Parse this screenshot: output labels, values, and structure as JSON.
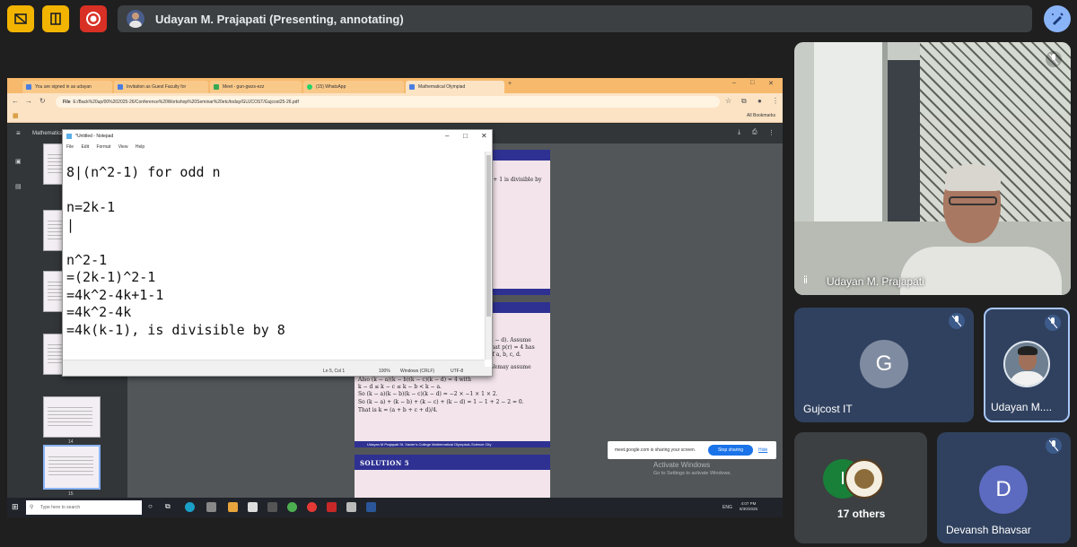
{
  "meet": {
    "presenter_label": "Udayan M. Prajapati (Presenting, annotating)",
    "participants": [
      {
        "name": "Udayan M. Prajapati"
      },
      {
        "name": "Gujcost IT",
        "initial": "G",
        "color": "#7f8ba0"
      },
      {
        "name": "Udayan M...."
      },
      {
        "summary": "17 others",
        "initial": "I",
        "initial_color": "#188038"
      },
      {
        "name": "Devansh Bhavsar",
        "initial": "D",
        "color": "#5c6bc0"
      }
    ]
  },
  "browser": {
    "tabs": [
      {
        "label": "You are signed in as udayan"
      },
      {
        "label": "Invitation as Guest Faculty for"
      },
      {
        "label": "Meet - gun-gwzs-ezz"
      },
      {
        "label": "(15) WhatsApp"
      },
      {
        "label": "Mathematical Olympiad"
      }
    ],
    "new_tab": "+",
    "file_label": "File",
    "url": "E:/Back%20up/00%202025-26/Conference%20Workshop%20Seminar%20etc/today/GUJCOST/Gujcost25-26.pdf",
    "all_bookmarks": "All Bookmarks",
    "pdf_title": "Mathematica",
    "thumb_numbers": [
      "14",
      "15"
    ]
  },
  "notepad": {
    "title": "*Untitled - Notepad",
    "menu": [
      "File",
      "Edit",
      "Format",
      "View",
      "Help"
    ],
    "content": "8|(n^2-1) for odd n\n\nn=2k-1\n|\n\nn^2-1\n=(2k-1)^2-1\n=4k^2-4k+1-1\n=4k^2-4k\n=4k(k-1), is divisible by 8",
    "status": {
      "pos": "Ln 5, Col 1",
      "zoom": "100%",
      "eol": "Windows (CRLF)",
      "encoding": "UTF-8"
    }
  },
  "pdf_pages": {
    "page1_snippet": "² + 1 is divisible by",
    "page2_lines": [
      "c)(x − d). Assume",
      "that p(r) = 4 has",
      "of a, b, c, d.",
      "Wemay assume",
      "Also (k − a)(k − b)(k − c)(k − d) = 4 with",
      "k − d ≤ k − c ≤ k − b < k − a.",
      "So (k − a)(k − b)(k − c)(k − d) = −2 × −1 × 1 × 2.",
      "So (k − a) + (k − b) + (k − c) + (k − d) = 1 − 1 + 2 − 2 = 0.",
      "That is k = (a + b + c + d)/4."
    ],
    "footer": "Udayan M Prajapati St. Xavier's College     Mathematical Olympiad–Science City",
    "solution5": "SOLUTION 5"
  },
  "share": {
    "text": "meet.google.com is sharing your screen.",
    "stop": "Stop sharing",
    "hide": "Hide"
  },
  "activate": {
    "line1": "Activate Windows",
    "line2": "Go to Settings to activate Windows."
  },
  "taskbar": {
    "search": "Type here to search",
    "lang": "ENG",
    "time": "4:07 PM",
    "date": "8/30/2025"
  }
}
